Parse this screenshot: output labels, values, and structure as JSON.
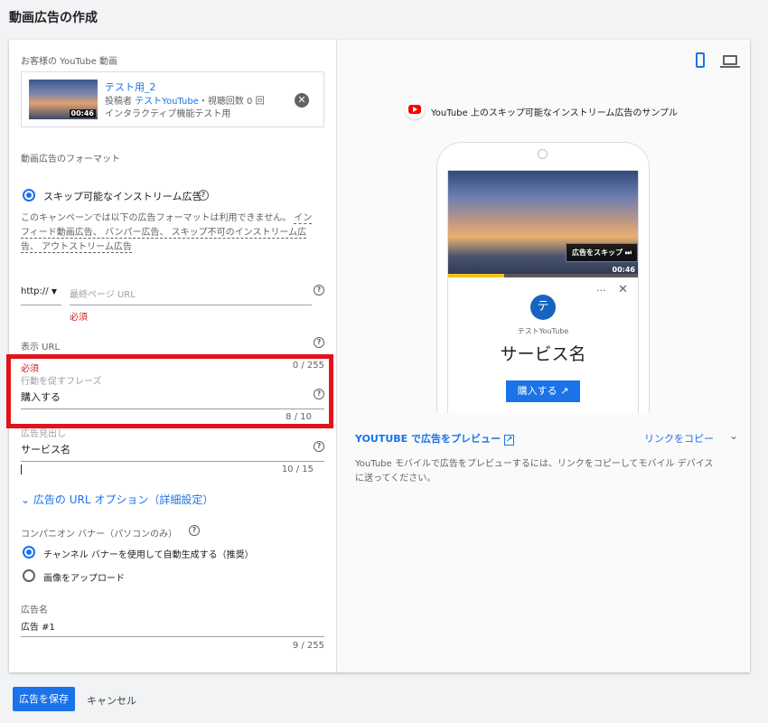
{
  "page_title": "動画広告の作成",
  "video_section": {
    "label": "お客様の YouTube 動画",
    "video_title": "テスト用_2",
    "by_prefix": "投稿者",
    "channel": "テストYouTube",
    "views": "・視聴回数 0 回",
    "description": "インタラクティブ機能テスト用",
    "duration": "00:46"
  },
  "format_section": {
    "label": "動画広告のフォーマット",
    "option_label": "スキップ可能なインストリーム広告",
    "note_prefix": "このキャンペーンでは以下の広告フォーマットは利用できません。",
    "note_line1_link": "イン",
    "note_line2": "フィード動画広告、 バンパー広告、 スキップ不可のインストリーム広",
    "note_line3": "告、 アウトストリーム広告"
  },
  "final_url": {
    "protocol": "http://",
    "placeholder": "最終ページ URL",
    "required": "必須"
  },
  "display_url": {
    "label": "表示 URL",
    "required": "必須",
    "counter": "0 / 255"
  },
  "cta": {
    "label": "行動を促すフレーズ",
    "value": "購入する",
    "counter": "8 / 10"
  },
  "headline": {
    "label": "広告見出し",
    "value": "サービス名",
    "counter": "10 / 15"
  },
  "url_options": {
    "label": "広告の URL オプション（詳細設定）"
  },
  "companion": {
    "label": "コンパニオン バナー（パソコンのみ）",
    "option1": "チャンネル バナーを使用して自動生成する（推奨）",
    "option2": "画像をアップロード"
  },
  "ad_name": {
    "label": "広告名",
    "value": "広告 #1",
    "counter": "9 / 255"
  },
  "preview": {
    "header": "YouTube 上のスキップ可能なインストリーム広告のサンプル",
    "skip_label": "広告をスキップ",
    "duration": "00:46",
    "avatar_letter": "テ",
    "channel": "テストYouTube",
    "headline": "サービス名",
    "cta": "購入する",
    "preview_link": "YOUTUBE で広告をプレビュー",
    "copy_link": "リンクをコピー",
    "help_text_line1": "YouTube モバイルで広告をプレビューするには、リンクをコピーしてモバイル デバイス",
    "help_text_line2": "に送ってください。"
  },
  "footer": {
    "save": "広告を保存",
    "cancel": "キャンセル"
  },
  "colors": {
    "accent": "#1a73e8",
    "highlight": "#e3131b",
    "youtube_red": "#ff0000"
  }
}
